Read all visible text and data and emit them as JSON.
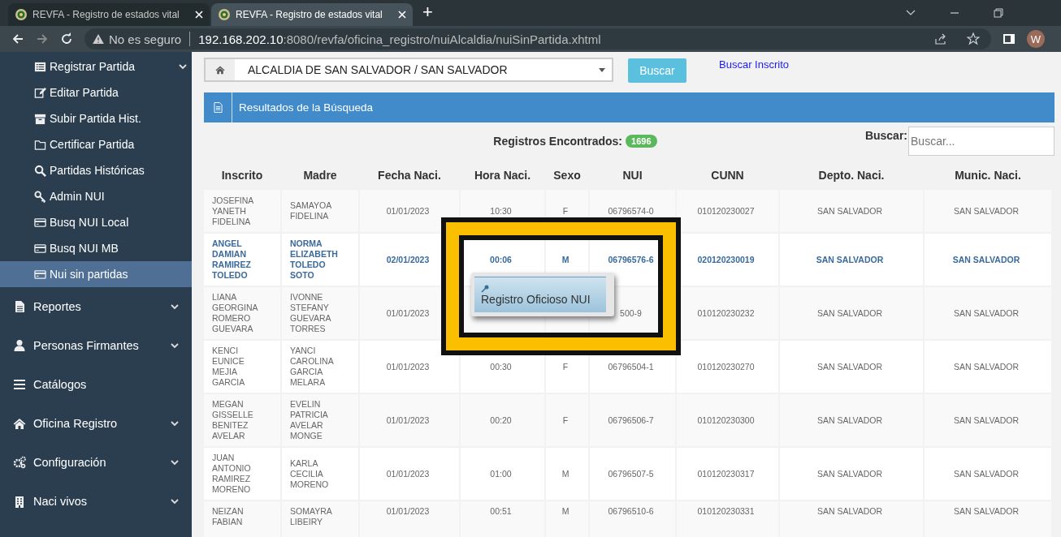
{
  "browser": {
    "tabs": [
      {
        "title": "REVFA - Registro de estados vital",
        "selected": false
      },
      {
        "title": "REVFA - Registro de estados vital",
        "selected": true
      }
    ],
    "new_tab": "+",
    "security": "No es seguro",
    "url_host": "192.168.202.10",
    "url_path": ":8080/revfa/oficina_registro/nuiAlcaldia/nuiSinPartida.xhtml",
    "avatar": "W"
  },
  "sidebar": {
    "submenu_items": [
      {
        "label": "Registrar Partida",
        "expandable": true,
        "selected": false
      },
      {
        "label": "Editar Partida",
        "expandable": false,
        "selected": false
      },
      {
        "label": "Subir Partida Hist.",
        "expandable": false,
        "selected": false
      },
      {
        "label": "Certificar Partida",
        "expandable": false,
        "selected": false
      },
      {
        "label": "Partidas Históricas",
        "expandable": false,
        "selected": false
      },
      {
        "label": "Admin NUI",
        "expandable": false,
        "selected": false
      },
      {
        "label": "Busq NUI Local",
        "expandable": false,
        "selected": false
      },
      {
        "label": "Busq NUI MB",
        "expandable": false,
        "selected": false
      },
      {
        "label": "Nui sin partidas",
        "expandable": false,
        "selected": true
      }
    ],
    "menu_items": [
      {
        "label": "Reportes",
        "expandable": true
      },
      {
        "label": "Personas Firmantes",
        "expandable": true
      },
      {
        "label": "Catálogos",
        "expandable": false
      },
      {
        "label": "Oficina Registro",
        "expandable": true
      },
      {
        "label": "Configuración",
        "expandable": true
      },
      {
        "label": "Naci vivos",
        "expandable": true
      }
    ]
  },
  "filter": {
    "office": "ALCALDIA DE SAN SALVADOR / SAN SALVADOR",
    "search_button": "Buscar",
    "link": "Buscar Inscrito"
  },
  "panel": {
    "title": "Resultados de la Búsqueda",
    "count_label": "Registros Encontrados:",
    "count": "1696",
    "search_label": "Buscar:",
    "search_placeholder": "Buscar..."
  },
  "table": {
    "columns": [
      "Inscrito",
      "Madre",
      "Fecha Naci.",
      "Hora Naci.",
      "Sexo",
      "NUI",
      "CUNN",
      "Depto. Naci.",
      "Munic. Naci."
    ],
    "rows": [
      {
        "selected": false,
        "cells": [
          "JOSEFINA YANETH FIDELINA",
          "SAMAYOA FIDELINA",
          "01/01/2023",
          "10:30",
          "F",
          "06796574-0",
          "010120230027",
          "SAN SALVADOR",
          "SAN SALVADOR"
        ]
      },
      {
        "selected": true,
        "cells": [
          "ANGEL DAMIAN RAMIREZ TOLEDO",
          "NORMA ELIZABETH TOLEDO SOTO",
          "02/01/2023",
          "00:06",
          "M",
          "06796576-6",
          "020120230019",
          "SAN SALVADOR",
          "SAN SALVADOR"
        ]
      },
      {
        "selected": false,
        "cells": [
          "LIANA GEORGINA ROMERO GUEVARA",
          "IVONNE STEFANY GUEVARA TORRES",
          "01/01/2023",
          null,
          null,
          "500-9",
          "010120230232",
          "SAN SALVADOR",
          "SAN SALVADOR"
        ]
      },
      {
        "selected": false,
        "cells": [
          "KENCI EUNICE MEJIA GARCIA",
          "YANCI CAROLINA GARCIA MELARA",
          "01/01/2023",
          "00:30",
          "F",
          "06796504-1",
          "010120230270",
          "SAN SALVADOR",
          "SAN SALVADOR"
        ]
      },
      {
        "selected": false,
        "cells": [
          "MEGAN GISSELLE BENITEZ AVELAR",
          "EVELIN PATRICIA AVELAR MONGE",
          "01/01/2023",
          "00:20",
          "F",
          "06796506-7",
          "010120230300",
          "SAN SALVADOR",
          "SAN SALVADOR"
        ]
      },
      {
        "selected": false,
        "cells": [
          "JUAN ANTONIO RAMIREZ MORENO",
          "KARLA CECILIA MORENO",
          "01/01/2023",
          "01:00",
          "M",
          "06796507-5",
          "010120230317",
          "SAN SALVADOR",
          "SAN SALVADOR"
        ]
      },
      {
        "selected": false,
        "cells": [
          "NEIZAN FABIAN",
          "SOMAYRA LIBEIRY",
          "01/01/2023",
          "00:51",
          "M",
          "06796510-6",
          "010120230331",
          "SAN SALVADOR",
          "SAN SALVADOR"
        ]
      }
    ]
  },
  "context_menu": {
    "items": [
      "Registro Oficioso NUI"
    ]
  }
}
